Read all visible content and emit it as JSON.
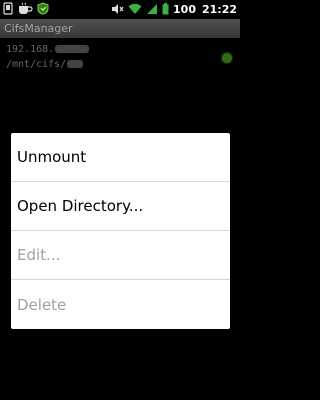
{
  "status_bar": {
    "battery_text": "100",
    "time": "21:22",
    "icons": [
      "notification-icon",
      "coffee-icon",
      "shield-icon",
      "mute-icon",
      "wifi-icon",
      "signal-icon",
      "battery-icon"
    ]
  },
  "app": {
    "title": "CifsManager"
  },
  "share": {
    "host_prefix": "192.168.",
    "mount_prefix": "/mnt/cifs/",
    "status_color": "#3f8f1c"
  },
  "context_menu": {
    "items": [
      {
        "label": "Unmount",
        "enabled": true
      },
      {
        "label": "Open Directory...",
        "enabled": true
      },
      {
        "label": "Edit...",
        "enabled": false
      },
      {
        "label": "Delete",
        "enabled": false
      }
    ]
  }
}
